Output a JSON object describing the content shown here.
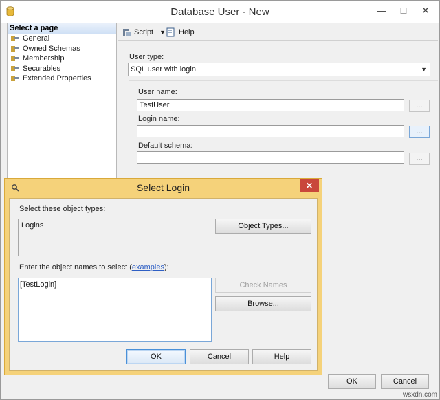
{
  "window": {
    "title": "Database User - New"
  },
  "sidebar": {
    "header": "Select a page",
    "items": [
      {
        "label": "General"
      },
      {
        "label": "Owned Schemas"
      },
      {
        "label": "Membership"
      },
      {
        "label": "Securables"
      },
      {
        "label": "Extended Properties"
      }
    ]
  },
  "toolbar": {
    "script_label": "Script",
    "help_label": "Help"
  },
  "form": {
    "user_type_label": "User type:",
    "user_type_value": "SQL user with login",
    "user_name_label": "User name:",
    "user_name_value": "TestUser",
    "login_name_label": "Login name:",
    "login_name_value": "",
    "default_schema_label": "Default schema:",
    "default_schema_value": "",
    "ellipsis": "..."
  },
  "main_buttons": {
    "ok": "OK",
    "cancel": "Cancel"
  },
  "dialog": {
    "title": "Select Login",
    "object_types_label": "Select these object types:",
    "object_types_value": "Logins",
    "object_types_button": "Object Types...",
    "names_label_prefix": "Enter the object names to select (",
    "names_label_link": "examples",
    "names_label_suffix": "):",
    "names_value": "[TestLogin]",
    "check_names_button": "Check Names",
    "browse_button": "Browse...",
    "ok_button": "OK",
    "cancel_button": "Cancel",
    "help_button": "Help"
  },
  "watermark": "wsxdn.com",
  "colors": {
    "dialog_frame": "#f5d27a",
    "close_button": "#c9473b",
    "link": "#2e5fc4"
  }
}
